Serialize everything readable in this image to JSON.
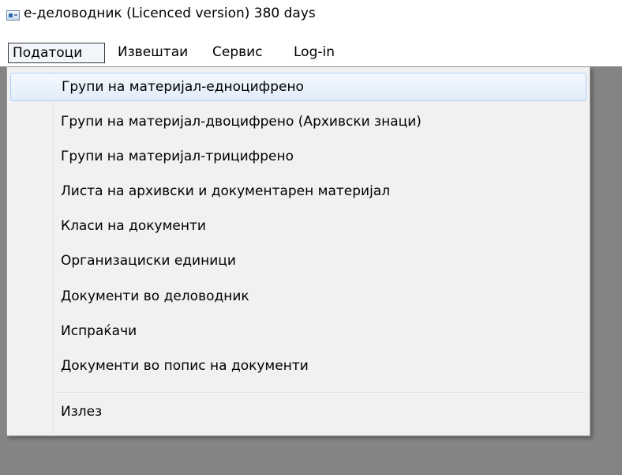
{
  "window": {
    "title": "e-деловодник (Licenced version) 380 days",
    "icon": "app-window-icon"
  },
  "menubar": {
    "items": [
      {
        "label": "Податоци",
        "active": true
      },
      {
        "label": "Извештаи",
        "active": false
      },
      {
        "label": "Сервис",
        "active": false
      },
      {
        "label": "Log-in",
        "active": false
      }
    ]
  },
  "dropdown": {
    "items": [
      {
        "label": "Групи на материјал-едноцифрено",
        "highlighted": true
      },
      {
        "label": "Групи на материјал-двоцифрено (Архивски знаци)"
      },
      {
        "label": "Групи на материјал-трицифрено"
      },
      {
        "label": "Листа на архивски и документарен материјал"
      },
      {
        "label": "Класи на документи"
      },
      {
        "label": "Организациски единици"
      },
      {
        "label": "Документи во деловодник"
      },
      {
        "label": "Испраќачи"
      },
      {
        "label": "Документи во попис на документи"
      }
    ],
    "exit_label": "Излез"
  },
  "colors": {
    "desktop_background": "#848484",
    "menu_background": "#f1f1f1",
    "highlight_border": "#aecff7"
  }
}
